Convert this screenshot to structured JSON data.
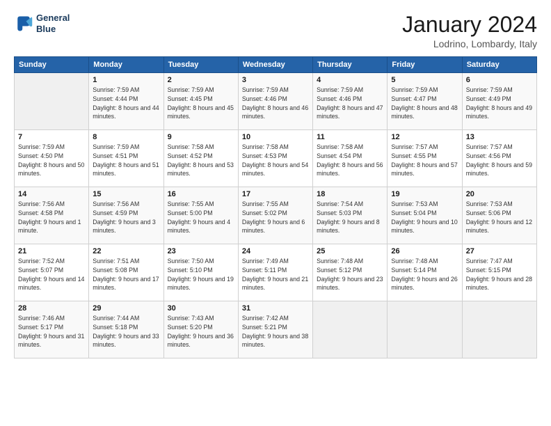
{
  "logo": {
    "line1": "General",
    "line2": "Blue"
  },
  "title": "January 2024",
  "location": "Lodrino, Lombardy, Italy",
  "days_of_week": [
    "Sunday",
    "Monday",
    "Tuesday",
    "Wednesday",
    "Thursday",
    "Friday",
    "Saturday"
  ],
  "weeks": [
    [
      {
        "day": "",
        "empty": true
      },
      {
        "day": "1",
        "sunrise": "7:59 AM",
        "sunset": "4:44 PM",
        "daylight": "8 hours and 44 minutes."
      },
      {
        "day": "2",
        "sunrise": "7:59 AM",
        "sunset": "4:45 PM",
        "daylight": "8 hours and 45 minutes."
      },
      {
        "day": "3",
        "sunrise": "7:59 AM",
        "sunset": "4:46 PM",
        "daylight": "8 hours and 46 minutes."
      },
      {
        "day": "4",
        "sunrise": "7:59 AM",
        "sunset": "4:46 PM",
        "daylight": "8 hours and 47 minutes."
      },
      {
        "day": "5",
        "sunrise": "7:59 AM",
        "sunset": "4:47 PM",
        "daylight": "8 hours and 48 minutes."
      },
      {
        "day": "6",
        "sunrise": "7:59 AM",
        "sunset": "4:49 PM",
        "daylight": "8 hours and 49 minutes."
      }
    ],
    [
      {
        "day": "7",
        "sunrise": "7:59 AM",
        "sunset": "4:50 PM",
        "daylight": "8 hours and 50 minutes."
      },
      {
        "day": "8",
        "sunrise": "7:59 AM",
        "sunset": "4:51 PM",
        "daylight": "8 hours and 51 minutes."
      },
      {
        "day": "9",
        "sunrise": "7:58 AM",
        "sunset": "4:52 PM",
        "daylight": "8 hours and 53 minutes."
      },
      {
        "day": "10",
        "sunrise": "7:58 AM",
        "sunset": "4:53 PM",
        "daylight": "8 hours and 54 minutes."
      },
      {
        "day": "11",
        "sunrise": "7:58 AM",
        "sunset": "4:54 PM",
        "daylight": "8 hours and 56 minutes."
      },
      {
        "day": "12",
        "sunrise": "7:57 AM",
        "sunset": "4:55 PM",
        "daylight": "8 hours and 57 minutes."
      },
      {
        "day": "13",
        "sunrise": "7:57 AM",
        "sunset": "4:56 PM",
        "daylight": "8 hours and 59 minutes."
      }
    ],
    [
      {
        "day": "14",
        "sunrise": "7:56 AM",
        "sunset": "4:58 PM",
        "daylight": "9 hours and 1 minute."
      },
      {
        "day": "15",
        "sunrise": "7:56 AM",
        "sunset": "4:59 PM",
        "daylight": "9 hours and 3 minutes."
      },
      {
        "day": "16",
        "sunrise": "7:55 AM",
        "sunset": "5:00 PM",
        "daylight": "9 hours and 4 minutes."
      },
      {
        "day": "17",
        "sunrise": "7:55 AM",
        "sunset": "5:02 PM",
        "daylight": "9 hours and 6 minutes."
      },
      {
        "day": "18",
        "sunrise": "7:54 AM",
        "sunset": "5:03 PM",
        "daylight": "9 hours and 8 minutes."
      },
      {
        "day": "19",
        "sunrise": "7:53 AM",
        "sunset": "5:04 PM",
        "daylight": "9 hours and 10 minutes."
      },
      {
        "day": "20",
        "sunrise": "7:53 AM",
        "sunset": "5:06 PM",
        "daylight": "9 hours and 12 minutes."
      }
    ],
    [
      {
        "day": "21",
        "sunrise": "7:52 AM",
        "sunset": "5:07 PM",
        "daylight": "9 hours and 14 minutes."
      },
      {
        "day": "22",
        "sunrise": "7:51 AM",
        "sunset": "5:08 PM",
        "daylight": "9 hours and 17 minutes."
      },
      {
        "day": "23",
        "sunrise": "7:50 AM",
        "sunset": "5:10 PM",
        "daylight": "9 hours and 19 minutes."
      },
      {
        "day": "24",
        "sunrise": "7:49 AM",
        "sunset": "5:11 PM",
        "daylight": "9 hours and 21 minutes."
      },
      {
        "day": "25",
        "sunrise": "7:48 AM",
        "sunset": "5:12 PM",
        "daylight": "9 hours and 23 minutes."
      },
      {
        "day": "26",
        "sunrise": "7:48 AM",
        "sunset": "5:14 PM",
        "daylight": "9 hours and 26 minutes."
      },
      {
        "day": "27",
        "sunrise": "7:47 AM",
        "sunset": "5:15 PM",
        "daylight": "9 hours and 28 minutes."
      }
    ],
    [
      {
        "day": "28",
        "sunrise": "7:46 AM",
        "sunset": "5:17 PM",
        "daylight": "9 hours and 31 minutes."
      },
      {
        "day": "29",
        "sunrise": "7:44 AM",
        "sunset": "5:18 PM",
        "daylight": "9 hours and 33 minutes."
      },
      {
        "day": "30",
        "sunrise": "7:43 AM",
        "sunset": "5:20 PM",
        "daylight": "9 hours and 36 minutes."
      },
      {
        "day": "31",
        "sunrise": "7:42 AM",
        "sunset": "5:21 PM",
        "daylight": "9 hours and 38 minutes."
      },
      {
        "day": "",
        "empty": true
      },
      {
        "day": "",
        "empty": true
      },
      {
        "day": "",
        "empty": true
      }
    ]
  ]
}
